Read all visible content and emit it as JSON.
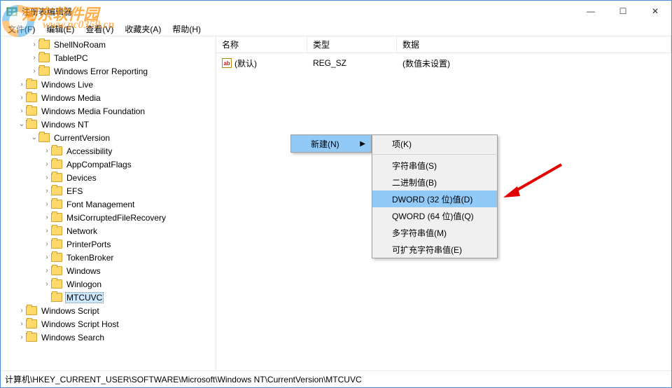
{
  "window": {
    "title": "注册表编辑器",
    "minimize": "—",
    "maximize": "☐",
    "close": "✕"
  },
  "watermark": {
    "line1": "河东软件园",
    "line2": "www.pc0359.cn"
  },
  "menu": {
    "file": "文件(F)",
    "edit": "编辑(E)",
    "view": "查看(V)",
    "favorites": "收藏夹(A)",
    "help": "帮助(H)"
  },
  "tree": {
    "items": [
      {
        "indent": 2,
        "exp": "›",
        "label": "ShellNoRoam"
      },
      {
        "indent": 2,
        "exp": "›",
        "label": "TabletPC"
      },
      {
        "indent": 2,
        "exp": "›",
        "label": "Windows Error Reporting"
      },
      {
        "indent": 1,
        "exp": "›",
        "label": "Windows Live"
      },
      {
        "indent": 1,
        "exp": "›",
        "label": "Windows Media"
      },
      {
        "indent": 1,
        "exp": "›",
        "label": "Windows Media Foundation"
      },
      {
        "indent": 1,
        "exp": "⌄",
        "label": "Windows NT"
      },
      {
        "indent": 2,
        "exp": "⌄",
        "label": "CurrentVersion"
      },
      {
        "indent": 3,
        "exp": "›",
        "label": "Accessibility"
      },
      {
        "indent": 3,
        "exp": "›",
        "label": "AppCompatFlags"
      },
      {
        "indent": 3,
        "exp": "›",
        "label": "Devices"
      },
      {
        "indent": 3,
        "exp": "›",
        "label": "EFS"
      },
      {
        "indent": 3,
        "exp": "›",
        "label": "Font Management"
      },
      {
        "indent": 3,
        "exp": "›",
        "label": "MsiCorruptedFileRecovery"
      },
      {
        "indent": 3,
        "exp": "›",
        "label": "Network"
      },
      {
        "indent": 3,
        "exp": "›",
        "label": "PrinterPorts"
      },
      {
        "indent": 3,
        "exp": "›",
        "label": "TokenBroker"
      },
      {
        "indent": 3,
        "exp": "›",
        "label": "Windows"
      },
      {
        "indent": 3,
        "exp": "›",
        "label": "Winlogon"
      },
      {
        "indent": 3,
        "exp": "",
        "label": "MTCUVC",
        "selected": true
      },
      {
        "indent": 1,
        "exp": "›",
        "label": "Windows Script"
      },
      {
        "indent": 1,
        "exp": "›",
        "label": "Windows Script Host"
      },
      {
        "indent": 1,
        "exp": "›",
        "label": "Windows Search"
      }
    ]
  },
  "list": {
    "headers": {
      "name": "名称",
      "type": "类型",
      "data": "数据"
    },
    "row": {
      "icon": "ab",
      "name": "(默认)",
      "type": "REG_SZ",
      "data": "(数值未设置)"
    }
  },
  "context": {
    "new": "新建(N)",
    "sub": {
      "key": "项(K)",
      "string": "字符串值(S)",
      "binary": "二进制值(B)",
      "dword": "DWORD (32 位)值(D)",
      "qword": "QWORD (64 位)值(Q)",
      "multi": "多字符串值(M)",
      "expand": "可扩充字符串值(E)"
    }
  },
  "statusbar": "计算机\\HKEY_CURRENT_USER\\SOFTWARE\\Microsoft\\Windows NT\\CurrentVersion\\MTCUVC"
}
